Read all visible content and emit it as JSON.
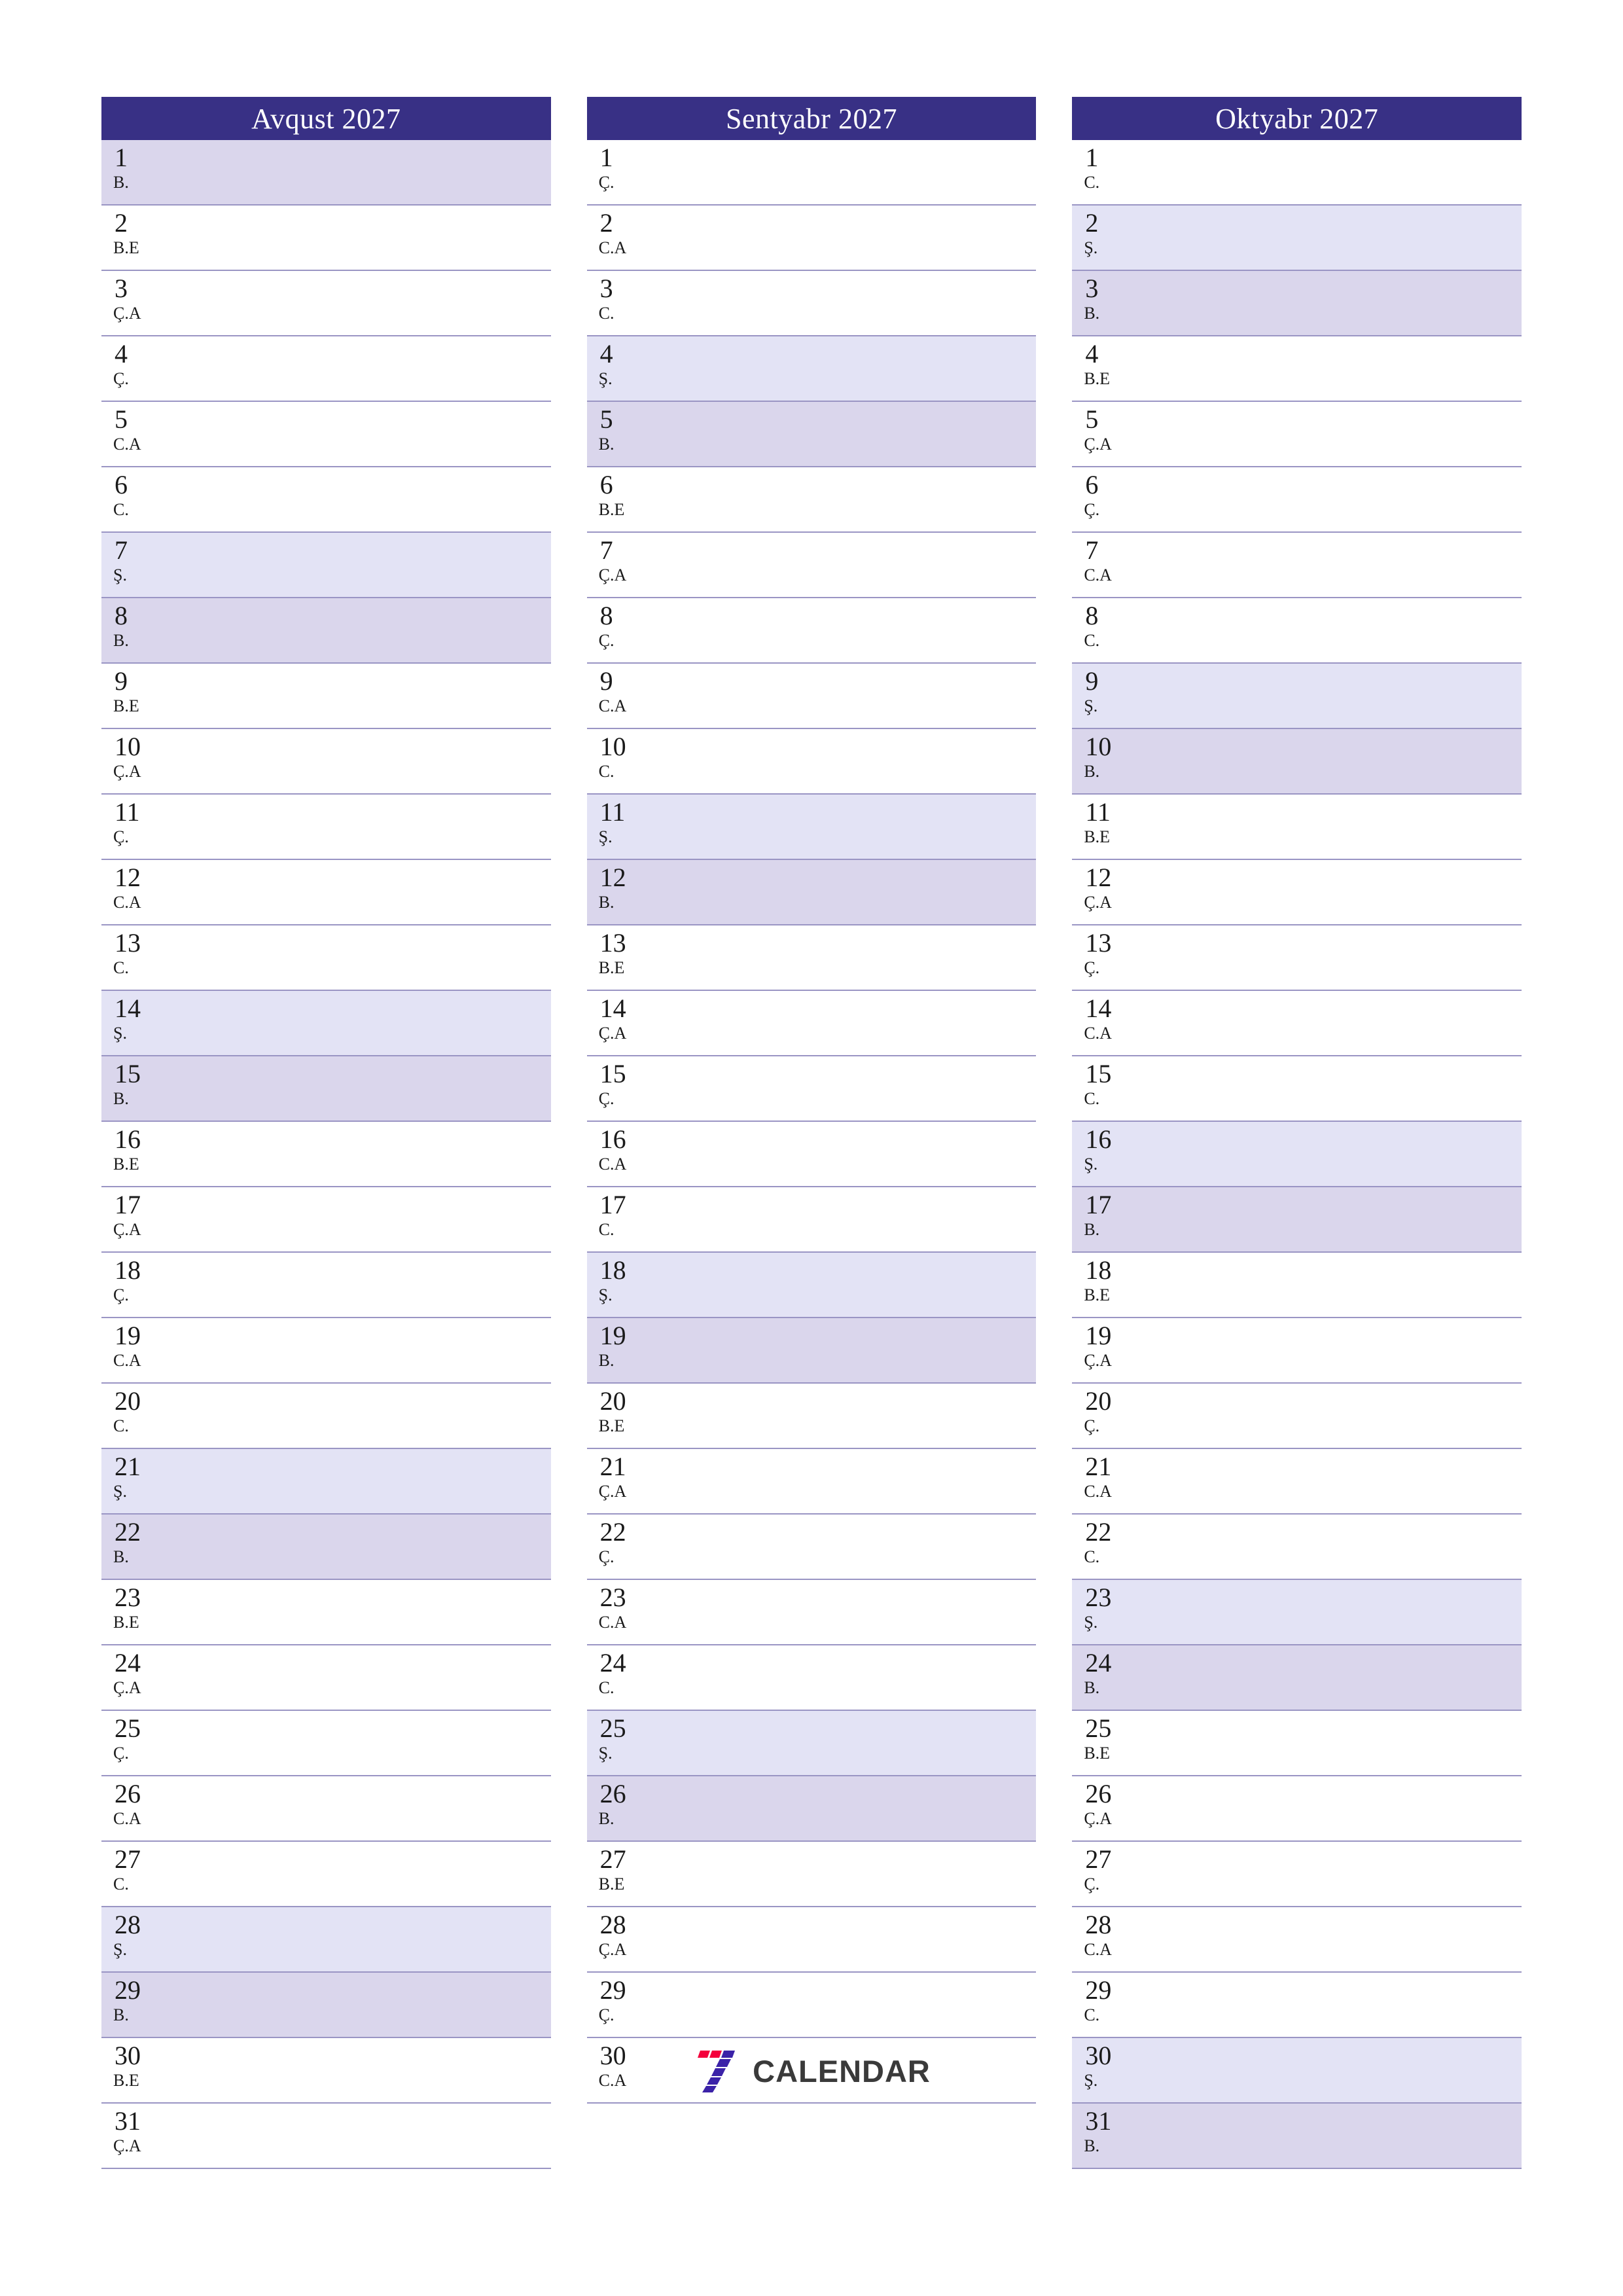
{
  "document": {
    "kind": "three-month-planner",
    "year": "2027",
    "page_size": "A4 portrait"
  },
  "colors": {
    "header_bg": "#383085",
    "header_text": "#ffffff",
    "row_border": "#9a95c4",
    "saturday_bg": "#e3e3f5",
    "sunday_bg": "#dad6ec",
    "page_bg": "#ffffff",
    "logo_red": "#f4003c",
    "logo_purple": "#3b22a8",
    "logo_text": "#3a3a3a"
  },
  "weekday_abbreviations": {
    "monday": "B.E",
    "tuesday": "Ç.A",
    "wednesday": "Ç.",
    "thursday": "C.A",
    "friday": "C.",
    "saturday": "Ş.",
    "sunday": "B."
  },
  "logo": {
    "mark_name": "seven-calendar-logo-mark",
    "text": "CALENDAR"
  },
  "months": [
    {
      "title": "Avqust 2027",
      "name": "Avqust",
      "days": [
        {
          "n": "1",
          "abbr": "B.",
          "type": "sun"
        },
        {
          "n": "2",
          "abbr": "B.E",
          "type": "week"
        },
        {
          "n": "3",
          "abbr": "Ç.A",
          "type": "week"
        },
        {
          "n": "4",
          "abbr": "Ç.",
          "type": "week"
        },
        {
          "n": "5",
          "abbr": "C.A",
          "type": "week"
        },
        {
          "n": "6",
          "abbr": "C.",
          "type": "week"
        },
        {
          "n": "7",
          "abbr": "Ş.",
          "type": "sat"
        },
        {
          "n": "8",
          "abbr": "B.",
          "type": "sun"
        },
        {
          "n": "9",
          "abbr": "B.E",
          "type": "week"
        },
        {
          "n": "10",
          "abbr": "Ç.A",
          "type": "week"
        },
        {
          "n": "11",
          "abbr": "Ç.",
          "type": "week"
        },
        {
          "n": "12",
          "abbr": "C.A",
          "type": "week"
        },
        {
          "n": "13",
          "abbr": "C.",
          "type": "week"
        },
        {
          "n": "14",
          "abbr": "Ş.",
          "type": "sat"
        },
        {
          "n": "15",
          "abbr": "B.",
          "type": "sun"
        },
        {
          "n": "16",
          "abbr": "B.E",
          "type": "week"
        },
        {
          "n": "17",
          "abbr": "Ç.A",
          "type": "week"
        },
        {
          "n": "18",
          "abbr": "Ç.",
          "type": "week"
        },
        {
          "n": "19",
          "abbr": "C.A",
          "type": "week"
        },
        {
          "n": "20",
          "abbr": "C.",
          "type": "week"
        },
        {
          "n": "21",
          "abbr": "Ş.",
          "type": "sat"
        },
        {
          "n": "22",
          "abbr": "B.",
          "type": "sun"
        },
        {
          "n": "23",
          "abbr": "B.E",
          "type": "week"
        },
        {
          "n": "24",
          "abbr": "Ç.A",
          "type": "week"
        },
        {
          "n": "25",
          "abbr": "Ç.",
          "type": "week"
        },
        {
          "n": "26",
          "abbr": "C.A",
          "type": "week"
        },
        {
          "n": "27",
          "abbr": "C.",
          "type": "week"
        },
        {
          "n": "28",
          "abbr": "Ş.",
          "type": "sat"
        },
        {
          "n": "29",
          "abbr": "B.",
          "type": "sun"
        },
        {
          "n": "30",
          "abbr": "B.E",
          "type": "week"
        },
        {
          "n": "31",
          "abbr": "Ç.A",
          "type": "week"
        }
      ]
    },
    {
      "title": "Sentyabr 2027",
      "name": "Sentyabr",
      "days": [
        {
          "n": "1",
          "abbr": "Ç.",
          "type": "week"
        },
        {
          "n": "2",
          "abbr": "C.A",
          "type": "week"
        },
        {
          "n": "3",
          "abbr": "C.",
          "type": "week"
        },
        {
          "n": "4",
          "abbr": "Ş.",
          "type": "sat"
        },
        {
          "n": "5",
          "abbr": "B.",
          "type": "sun"
        },
        {
          "n": "6",
          "abbr": "B.E",
          "type": "week"
        },
        {
          "n": "7",
          "abbr": "Ç.A",
          "type": "week"
        },
        {
          "n": "8",
          "abbr": "Ç.",
          "type": "week"
        },
        {
          "n": "9",
          "abbr": "C.A",
          "type": "week"
        },
        {
          "n": "10",
          "abbr": "C.",
          "type": "week"
        },
        {
          "n": "11",
          "abbr": "Ş.",
          "type": "sat"
        },
        {
          "n": "12",
          "abbr": "B.",
          "type": "sun"
        },
        {
          "n": "13",
          "abbr": "B.E",
          "type": "week"
        },
        {
          "n": "14",
          "abbr": "Ç.A",
          "type": "week"
        },
        {
          "n": "15",
          "abbr": "Ç.",
          "type": "week"
        },
        {
          "n": "16",
          "abbr": "C.A",
          "type": "week"
        },
        {
          "n": "17",
          "abbr": "C.",
          "type": "week"
        },
        {
          "n": "18",
          "abbr": "Ş.",
          "type": "sat"
        },
        {
          "n": "19",
          "abbr": "B.",
          "type": "sun"
        },
        {
          "n": "20",
          "abbr": "B.E",
          "type": "week"
        },
        {
          "n": "21",
          "abbr": "Ç.A",
          "type": "week"
        },
        {
          "n": "22",
          "abbr": "Ç.",
          "type": "week"
        },
        {
          "n": "23",
          "abbr": "C.A",
          "type": "week"
        },
        {
          "n": "24",
          "abbr": "C.",
          "type": "week"
        },
        {
          "n": "25",
          "abbr": "Ş.",
          "type": "sat"
        },
        {
          "n": "26",
          "abbr": "B.",
          "type": "sun"
        },
        {
          "n": "27",
          "abbr": "B.E",
          "type": "week"
        },
        {
          "n": "28",
          "abbr": "Ç.A",
          "type": "week"
        },
        {
          "n": "29",
          "abbr": "Ç.",
          "type": "week"
        },
        {
          "n": "30",
          "abbr": "C.A",
          "type": "week"
        }
      ]
    },
    {
      "title": "Oktyabr 2027",
      "name": "Oktyabr",
      "days": [
        {
          "n": "1",
          "abbr": "C.",
          "type": "week"
        },
        {
          "n": "2",
          "abbr": "Ş.",
          "type": "sat"
        },
        {
          "n": "3",
          "abbr": "B.",
          "type": "sun"
        },
        {
          "n": "4",
          "abbr": "B.E",
          "type": "week"
        },
        {
          "n": "5",
          "abbr": "Ç.A",
          "type": "week"
        },
        {
          "n": "6",
          "abbr": "Ç.",
          "type": "week"
        },
        {
          "n": "7",
          "abbr": "C.A",
          "type": "week"
        },
        {
          "n": "8",
          "abbr": "C.",
          "type": "week"
        },
        {
          "n": "9",
          "abbr": "Ş.",
          "type": "sat"
        },
        {
          "n": "10",
          "abbr": "B.",
          "type": "sun"
        },
        {
          "n": "11",
          "abbr": "B.E",
          "type": "week"
        },
        {
          "n": "12",
          "abbr": "Ç.A",
          "type": "week"
        },
        {
          "n": "13",
          "abbr": "Ç.",
          "type": "week"
        },
        {
          "n": "14",
          "abbr": "C.A",
          "type": "week"
        },
        {
          "n": "15",
          "abbr": "C.",
          "type": "week"
        },
        {
          "n": "16",
          "abbr": "Ş.",
          "type": "sat"
        },
        {
          "n": "17",
          "abbr": "B.",
          "type": "sun"
        },
        {
          "n": "18",
          "abbr": "B.E",
          "type": "week"
        },
        {
          "n": "19",
          "abbr": "Ç.A",
          "type": "week"
        },
        {
          "n": "20",
          "abbr": "Ç.",
          "type": "week"
        },
        {
          "n": "21",
          "abbr": "C.A",
          "type": "week"
        },
        {
          "n": "22",
          "abbr": "C.",
          "type": "week"
        },
        {
          "n": "23",
          "abbr": "Ş.",
          "type": "sat"
        },
        {
          "n": "24",
          "abbr": "B.",
          "type": "sun"
        },
        {
          "n": "25",
          "abbr": "B.E",
          "type": "week"
        },
        {
          "n": "26",
          "abbr": "Ç.A",
          "type": "week"
        },
        {
          "n": "27",
          "abbr": "Ç.",
          "type": "week"
        },
        {
          "n": "28",
          "abbr": "C.A",
          "type": "week"
        },
        {
          "n": "29",
          "abbr": "C.",
          "type": "week"
        },
        {
          "n": "30",
          "abbr": "Ş.",
          "type": "sat"
        },
        {
          "n": "31",
          "abbr": "B.",
          "type": "sun"
        }
      ]
    }
  ]
}
